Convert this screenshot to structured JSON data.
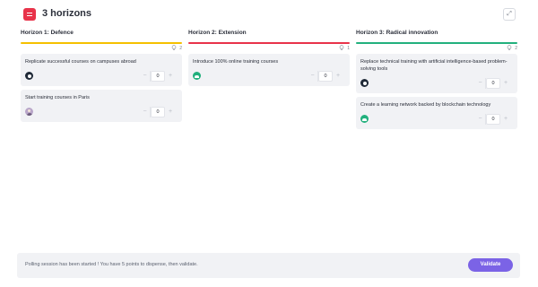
{
  "header": {
    "title": "3 horizons",
    "logo_icon": "app-logo-icon",
    "expand_icon": "expand-icon",
    "accent_color": "#e8334a"
  },
  "columns": [
    {
      "title": "Horizon 1: Defence",
      "color": "#f5c000",
      "count": "2",
      "cards": [
        {
          "text": "Replicate successful courses on campuses abroad",
          "avatar": "dark-avatar",
          "points": "0",
          "minus": "−",
          "plus": "+"
        },
        {
          "text": "Start training courses in Paris",
          "avatar": "photo-avatar",
          "points": "0",
          "minus": "−",
          "plus": "+"
        }
      ]
    },
    {
      "title": "Horizon 2: Extension",
      "color": "#e8334a",
      "count": "1",
      "cards": [
        {
          "text": "Introduce 100% online training courses",
          "avatar": "green-avatar",
          "points": "0",
          "minus": "−",
          "plus": "+"
        }
      ]
    },
    {
      "title": "Horizon 3: Radical innovation",
      "color": "#22b07d",
      "count": "2",
      "cards": [
        {
          "text": "Replace technical training with artificial intelligence-based problem-solving tools",
          "avatar": "dark-avatar",
          "points": "0",
          "minus": "−",
          "plus": "+"
        },
        {
          "text": "Create a learning network backed by blockchain technology",
          "avatar": "green-avatar",
          "points": "0",
          "minus": "−",
          "plus": "+"
        }
      ]
    }
  ],
  "footer": {
    "message": "Polling session has been started ! You have 5 points to dispense, then validate.",
    "validate_label": "Validate",
    "validate_color": "#7b63e6"
  }
}
